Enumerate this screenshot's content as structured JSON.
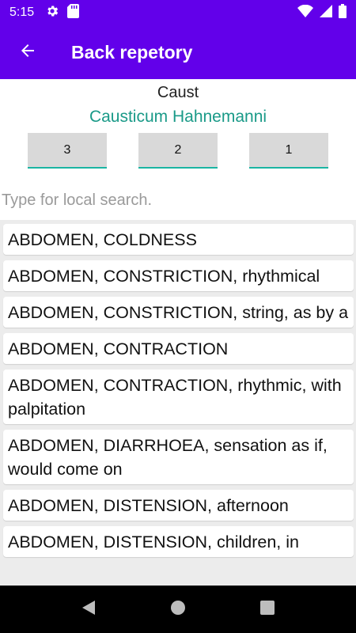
{
  "status_bar": {
    "time": "5:15",
    "left_icons": [
      "gear-icon",
      "sd-card-icon"
    ],
    "right_icons": [
      "wifi-icon",
      "cell-signal-icon",
      "battery-icon"
    ]
  },
  "app_bar": {
    "title": "Back repetory",
    "back_icon": "arrow-back-icon",
    "background_color": "#6200ea"
  },
  "remedy": {
    "abbreviation": "Caust",
    "full_name": "Causticum Hahnemanni",
    "name_color": "#1a9a88"
  },
  "grade_buttons": [
    {
      "label": "3"
    },
    {
      "label": "2"
    },
    {
      "label": "1"
    }
  ],
  "search": {
    "placeholder": "Type for local search.",
    "value": ""
  },
  "rubrics": [
    "ABDOMEN, COLDNESS",
    "ABDOMEN, CONSTRICTION, rhythmical",
    "ABDOMEN, CONSTRICTION, string, as by a",
    "ABDOMEN, CONTRACTION",
    "ABDOMEN, CONTRACTION, rhythmic, with palpitation",
    "ABDOMEN, DIARRHOEA, sensation as if, would come on",
    "ABDOMEN, DISTENSION, afternoon",
    "ABDOMEN, DISTENSION, children, in"
  ],
  "nav_bar": {
    "buttons": [
      "back-triangle-icon",
      "home-circle-icon",
      "recents-square-icon"
    ]
  }
}
